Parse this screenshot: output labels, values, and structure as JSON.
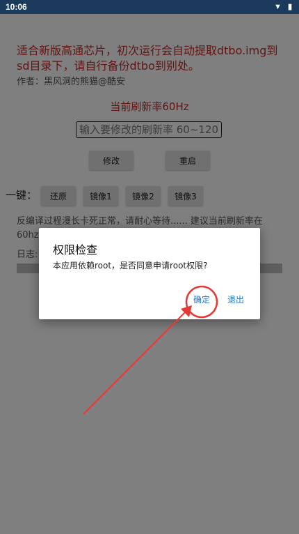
{
  "status_bar": {
    "time": "10:06",
    "wifi_icon": "wifi-icon",
    "battery_icon": "battery-icon"
  },
  "app": {
    "notice": "适合新版高通芯片，初次运行会自动提取dtbo.img到sd目录下，请自行备份dtbo到别处。",
    "author": "作者：黑风洞的熊猫@酷安",
    "current_rate": "当前刷新率60Hz",
    "rate_input_placeholder": "输入要修改的刷新率 60~120",
    "modify_label": "修改",
    "reboot_label": "重启",
    "onekey_label": "一键：",
    "restore_label": "还原",
    "mirror1_label": "镜像1",
    "mirror2_label": "镜像2",
    "mirror3_label": "镜像3",
    "progress_text": "反编译过程漫长卡死正常，请耐心等待...... 建议当前刷新率在60hz",
    "log_label": "日志:"
  },
  "dialog": {
    "title": "权限检查",
    "message": "本应用依赖root，是否同意申请root权限?",
    "ok_label": "确定",
    "exit_label": "退出"
  },
  "colors": {
    "status_bar": "#1b3a5c",
    "notice_red": "#c62828",
    "dialog_button": "#1976d2",
    "annotation_red": "#e53935"
  }
}
